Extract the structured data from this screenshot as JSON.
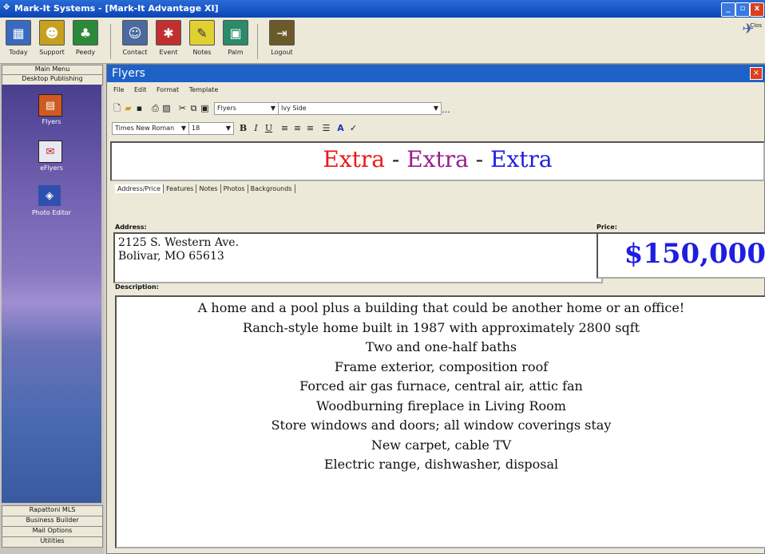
{
  "window": {
    "title": "Mark-It Systems - [Mark-It Advantage XI]",
    "buttons": [
      "_",
      "▫",
      "x"
    ]
  },
  "toolbar": {
    "items": [
      {
        "label": "Today",
        "icon": "calendar-icon",
        "color": "#3a6ac0"
      },
      {
        "label": "Support",
        "icon": "support-icon",
        "color": "#c8a020"
      },
      {
        "label": "Peedy",
        "icon": "parrot-icon",
        "color": "#2a8a3a"
      },
      {
        "label": "Contact",
        "icon": "contact-icon",
        "color": "#4a6aa0"
      },
      {
        "label": "Event",
        "icon": "event-icon",
        "color": "#c03030"
      },
      {
        "label": "Notes",
        "icon": "notes-icon",
        "color": "#e0d030"
      },
      {
        "label": "Palm",
        "icon": "palm-icon",
        "color": "#2a8a6a"
      },
      {
        "label": "Logout",
        "icon": "logout-icon",
        "color": "#6a5a2a"
      }
    ],
    "close_label": "Clos"
  },
  "sidebar": {
    "top_buttons": [
      "Main Menu",
      "Desktop Publishing"
    ],
    "tools": [
      {
        "label": "Flyers",
        "icon": "flyer-icon"
      },
      {
        "label": "eFlyers",
        "icon": "eflyer-icon"
      },
      {
        "label": "Photo Editor",
        "icon": "photo-editor-icon"
      }
    ],
    "bottom_buttons": [
      "Rapattoni MLS",
      "Business Builder",
      "Mail Options",
      "Utilities"
    ]
  },
  "flyers": {
    "title": "Flyers",
    "menu": [
      "File",
      "Edit",
      "Format",
      "Template"
    ],
    "template_combo": "Flyers",
    "style_combo": "Ivy Side",
    "ellipsis": "...",
    "font_combo": "Times New Roman",
    "size_combo": "18",
    "headline": {
      "parts": [
        {
          "text": "Extra",
          "color": "#e81818"
        },
        {
          "text": " - ",
          "color": "#222222"
        },
        {
          "text": "Extra",
          "color": "#9a1e8a"
        },
        {
          "text": " - ",
          "color": "#222222"
        },
        {
          "text": "Extra",
          "color": "#1e1ee0"
        }
      ]
    },
    "tabs": [
      "Address/Price",
      "Features",
      "Notes",
      "Photos",
      "Backgrounds"
    ],
    "address_label": "Address:",
    "address_lines": [
      "2125 S. Western Ave.",
      "Bolivar, MO 65613"
    ],
    "price_label": "Price:",
    "price": "$150,000",
    "description_label": "Description:",
    "description_lines": [
      "A home and a pool plus a building that could be another home or an office!",
      "Ranch-style home built in 1987 with approximately 2800 sqft",
      "Two and one-half baths",
      "Frame exterior, composition roof",
      "Forced air gas furnace, central air, attic fan",
      "Woodburning fireplace in Living Room",
      "Store windows and doors; all window coverings stay",
      "New carpet, cable TV",
      "Electric range, dishwasher, disposal"
    ]
  }
}
